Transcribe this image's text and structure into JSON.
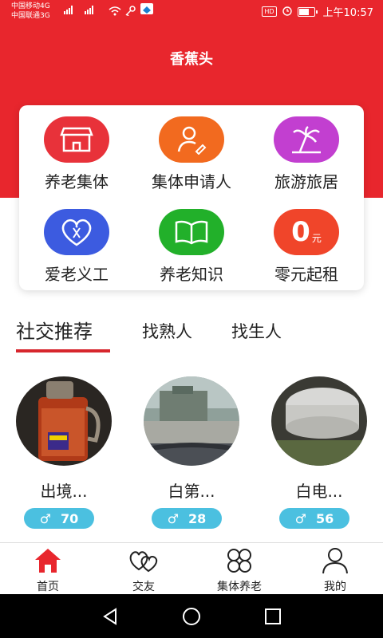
{
  "status_bar": {
    "carrier1": "中国移动4G",
    "carrier2": "中国联通3G",
    "signal1": "4G",
    "signal2": "3G",
    "hd": "HD",
    "time": "上午10:57"
  },
  "header": {
    "title": "香蕉头"
  },
  "grid": [
    {
      "label": "养老集体",
      "icon": "storefront-icon",
      "color": "#e8323a"
    },
    {
      "label": "集体申请人",
      "icon": "person-edit-icon",
      "color": "#f26a1f"
    },
    {
      "label": "旅游旅居",
      "icon": "palm-tree-icon",
      "color": "#c23fd0"
    },
    {
      "label": "爱老义工",
      "icon": "heart-yi-icon",
      "color": "#3c5be0"
    },
    {
      "label": "养老知识",
      "icon": "book-icon",
      "color": "#22b02a"
    },
    {
      "label": "零元起租",
      "icon": "zero-yuan-icon",
      "color": "#f0452a",
      "big": "0",
      "small": "元"
    }
  ],
  "tabs": [
    {
      "label": "社交推荐",
      "active": true
    },
    {
      "label": "找熟人",
      "active": false
    },
    {
      "label": "找生人",
      "active": false
    }
  ],
  "persons": [
    {
      "name": "出境...",
      "gender": "♂",
      "age": "70"
    },
    {
      "name": "白第...",
      "gender": "♂",
      "age": "28"
    },
    {
      "name": "白电...",
      "gender": "♂",
      "age": "56"
    }
  ],
  "bottom_nav": [
    {
      "label": "首页",
      "icon": "home-icon",
      "active": true
    },
    {
      "label": "交友",
      "icon": "hearts-icon",
      "active": false
    },
    {
      "label": "集体养老",
      "icon": "clover-icon",
      "active": false
    },
    {
      "label": "我的",
      "icon": "user-icon",
      "active": false
    }
  ],
  "colors": {
    "brand_red": "#e8262d",
    "badge_blue": "#4bc0e0"
  }
}
